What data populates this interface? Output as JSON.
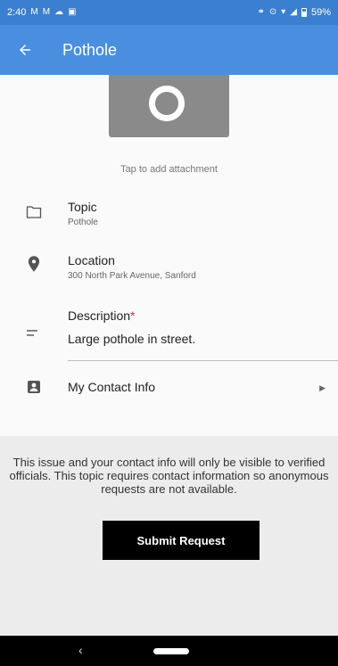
{
  "status_bar": {
    "time": "2:40",
    "battery_text": "59%",
    "icons": [
      "gmail-icon",
      "gmail-icon",
      "weather-icon",
      "calendar-icon",
      "link-icon",
      "location-icon",
      "wifi-icon",
      "signal-icon",
      "battery-icon"
    ]
  },
  "app_bar": {
    "title": "Pothole",
    "back_icon": "arrow-back-icon",
    "background": "#4a8ee0"
  },
  "attachment": {
    "caption": "Tap to add attachment",
    "icon": "camera-icon"
  },
  "fields": {
    "topic": {
      "label": "Topic",
      "value": "Pothole",
      "icon": "folder-icon"
    },
    "location": {
      "label": "Location",
      "value": "300 North Park Avenue, Sanford",
      "icon": "location-pin-icon"
    },
    "description": {
      "label": "Description",
      "required_mark": "*",
      "value": "Large pothole in street.",
      "icon": "short-text-icon"
    },
    "contact": {
      "label": "My Contact Info",
      "icon": "contact-card-icon",
      "chevron_icon": "chevron-right-icon"
    }
  },
  "footer": {
    "notice": "This issue and your contact info will only be visible to verified officials. This topic requires contact information so anonymous requests are not available.",
    "submit_label": "Submit Request"
  },
  "nav": {
    "back_icon": "nav-back-icon",
    "home_icon": "home-pill-icon"
  }
}
